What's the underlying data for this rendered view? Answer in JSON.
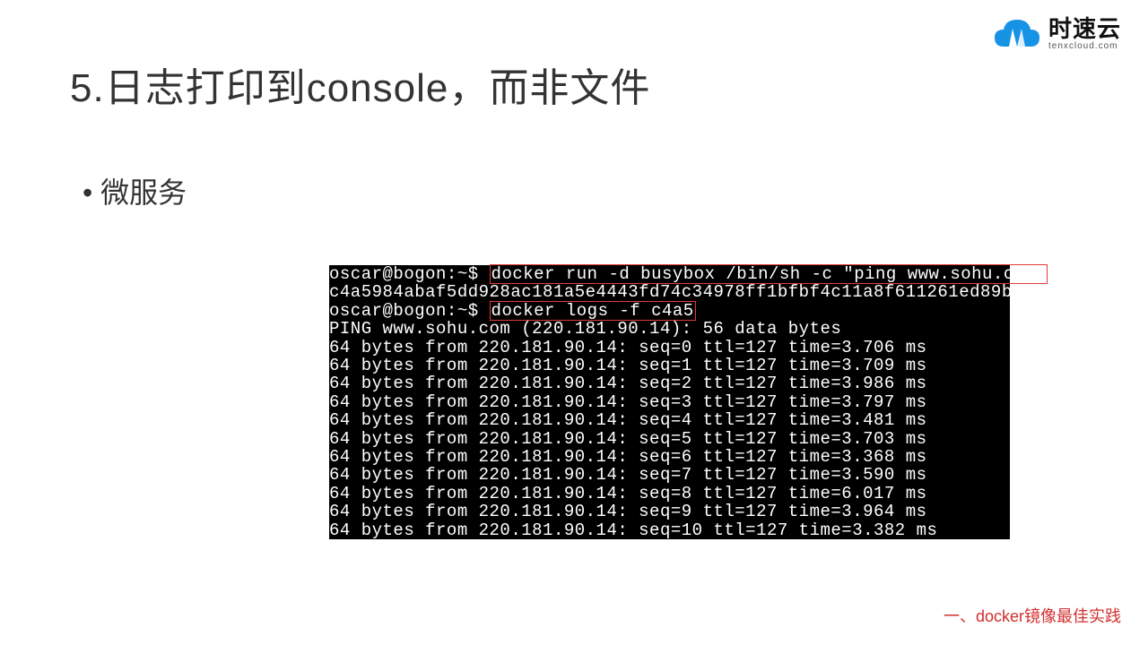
{
  "logo": {
    "cn": "时速云",
    "en": "tenxcloud.com"
  },
  "title": "5.日志打印到console，而非文件",
  "bullet": "微服务",
  "terminal": {
    "prompt": "oscar@bogon:~$",
    "cmd1": "docker run -d busybox /bin/sh -c \"ping www.sohu.com\"",
    "container_id": "c4a5984abaf5dd928ac181a5e4443fd74c34978ff1bfbf4c11a8f611261ed89b",
    "cmd2": "docker logs -f c4a5",
    "ping_header": "PING www.sohu.com (220.181.90.14): 56 data bytes",
    "ping_lines": [
      "64 bytes from 220.181.90.14: seq=0 ttl=127 time=3.706 ms",
      "64 bytes from 220.181.90.14: seq=1 ttl=127 time=3.709 ms",
      "64 bytes from 220.181.90.14: seq=2 ttl=127 time=3.986 ms",
      "64 bytes from 220.181.90.14: seq=3 ttl=127 time=3.797 ms",
      "64 bytes from 220.181.90.14: seq=4 ttl=127 time=3.481 ms",
      "64 bytes from 220.181.90.14: seq=5 ttl=127 time=3.703 ms",
      "64 bytes from 220.181.90.14: seq=6 ttl=127 time=3.368 ms",
      "64 bytes from 220.181.90.14: seq=7 ttl=127 time=3.590 ms",
      "64 bytes from 220.181.90.14: seq=8 ttl=127 time=6.017 ms",
      "64 bytes from 220.181.90.14: seq=9 ttl=127 time=3.964 ms",
      "64 bytes from 220.181.90.14: seq=10 ttl=127 time=3.382 ms"
    ]
  },
  "footer": "一、docker镜像最佳实践"
}
